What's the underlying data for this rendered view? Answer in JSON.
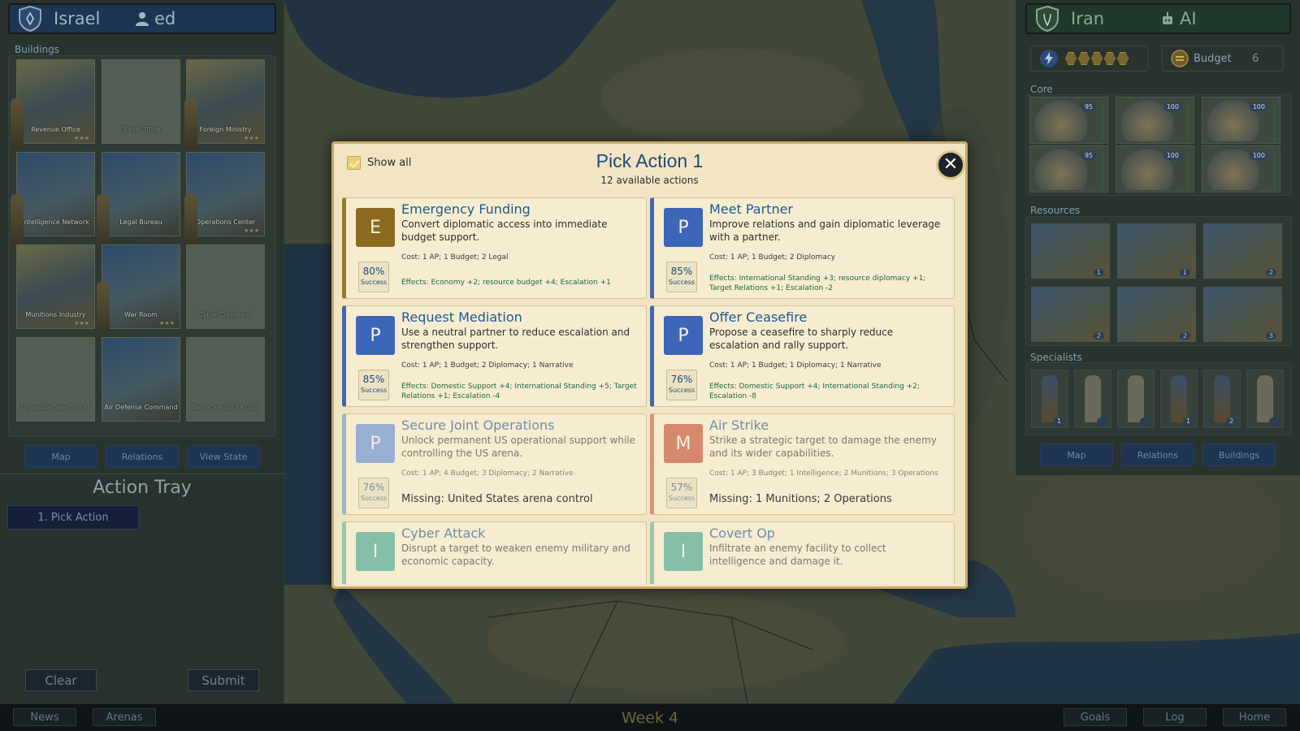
{
  "left_player": {
    "name": "Israel",
    "controller": "ed"
  },
  "right_player": {
    "name": "Iran",
    "controller": "AI",
    "budget_label": "Budget",
    "budget_value": "6",
    "ap_coins": 5
  },
  "left_panel": {
    "section_buildings": "Buildings",
    "buildings": [
      {
        "name": "Revenue Office",
        "state": "active"
      },
      {
        "name": "Trade Office",
        "state": "locked"
      },
      {
        "name": "Foreign Ministry",
        "state": "active"
      },
      {
        "name": "Intelligence Network",
        "state": "active"
      },
      {
        "name": "Legal Bureau",
        "state": "active"
      },
      {
        "name": "Operations Center",
        "state": "active"
      },
      {
        "name": "Munitions Industry",
        "state": "active"
      },
      {
        "name": "War Room",
        "state": "active"
      },
      {
        "name": "Cyber Command",
        "state": "locked"
      },
      {
        "name": "Legal Warfare Center",
        "state": "locked"
      },
      {
        "name": "Air Defense Command",
        "state": "active"
      },
      {
        "name": "Narrative Strike Unit",
        "state": "locked"
      }
    ],
    "buttons": {
      "map": "Map",
      "relations": "Relations",
      "view_state": "View State"
    },
    "action_tray_title": "Action Tray",
    "tray_slot": "1. Pick Action",
    "clear": "Clear",
    "submit": "Submit"
  },
  "right_panel": {
    "section_core": "Core",
    "core_values": [
      "95",
      "100",
      "100",
      "95",
      "100",
      "100"
    ],
    "section_resources": "Resources",
    "resource_counts": [
      "1",
      "1",
      "2",
      "2",
      "2",
      "3"
    ],
    "section_specialists": "Specialists",
    "specialist_counts": [
      "1",
      "",
      "",
      "1",
      "2",
      ""
    ],
    "buttons": {
      "map": "Map",
      "relations": "Relations",
      "buildings": "Buildings"
    }
  },
  "bottom_bar": {
    "news": "News",
    "arenas": "Arenas",
    "week": "Week 4",
    "goals": "Goals",
    "log": "Log",
    "home": "Home"
  },
  "modal": {
    "show_all_label": "Show all",
    "title": "Pick Action 1",
    "subtitle": "12 available actions",
    "close": "✕",
    "success_label": "Success",
    "actions": [
      {
        "letter": "E",
        "cat": "E",
        "enabled": true,
        "title": "Emergency Funding",
        "desc": "Convert diplomatic access into immediate budget support.",
        "cost": "Cost: 1 AP; 1 Budget; 2 Legal",
        "success": "80%",
        "effects": "Effects: Economy +2; resource budget +4; Escalation +1",
        "missing": ""
      },
      {
        "letter": "P",
        "cat": "P",
        "enabled": true,
        "title": "Meet Partner",
        "desc": "Improve relations and gain diplomatic leverage with a partner.",
        "cost": "Cost: 1 AP; 1 Budget; 2 Diplomacy",
        "success": "85%",
        "effects": "Effects: International Standing +3; resource diplomacy +1; Target Relations +1; Escalation -2",
        "missing": ""
      },
      {
        "letter": "P",
        "cat": "P",
        "enabled": true,
        "title": "Request Mediation",
        "desc": "Use a neutral partner to reduce escalation and strengthen support.",
        "cost": "Cost: 1 AP; 1 Budget; 2 Diplomacy; 1 Narrative",
        "success": "85%",
        "effects": "Effects: Domestic Support +4; International Standing +5; Target Relations +1; Escalation -4",
        "missing": ""
      },
      {
        "letter": "P",
        "cat": "P",
        "enabled": true,
        "title": "Offer Ceasefire",
        "desc": "Propose a ceasefire to sharply reduce escalation and rally support.",
        "cost": "Cost: 1 AP; 1 Budget; 1 Diplomacy; 1 Narrative",
        "success": "76%",
        "effects": "Effects: Domestic Support +4; International Standing +2; Escalation -8",
        "missing": ""
      },
      {
        "letter": "P",
        "cat": "P",
        "enabled": false,
        "title": "Secure Joint Operations",
        "desc": "Unlock permanent US operational support while controlling the US arena.",
        "cost": "Cost: 1 AP; 4 Budget; 3 Diplomacy; 2 Narrative",
        "success": "76%",
        "effects": "",
        "missing": "Missing: United States arena control"
      },
      {
        "letter": "M",
        "cat": "M",
        "enabled": false,
        "title": "Air Strike",
        "desc": "Strike a strategic target to damage the enemy and its wider capabilities.",
        "cost": "Cost: 1 AP; 3 Budget; 1 Intelligence; 2 Munitions; 3 Operations",
        "success": "57%",
        "effects": "",
        "missing": "Missing: 1 Munitions; 2 Operations"
      },
      {
        "letter": "I",
        "cat": "I",
        "enabled": false,
        "title": "Cyber Attack",
        "desc": "Disrupt a target to weaken enemy military and economic capacity.",
        "cost": "",
        "success": "",
        "effects": "",
        "missing": ""
      },
      {
        "letter": "I",
        "cat": "I",
        "enabled": false,
        "title": "Covert Op",
        "desc": "Infiltrate an enemy facility to collect intelligence and damage it.",
        "cost": "",
        "success": "",
        "effects": "",
        "missing": ""
      }
    ]
  },
  "colors": {
    "accent_blue": "#1f4a7a",
    "modal_bg": "#f2e5c3",
    "effects_green": "#1e6a3a"
  }
}
